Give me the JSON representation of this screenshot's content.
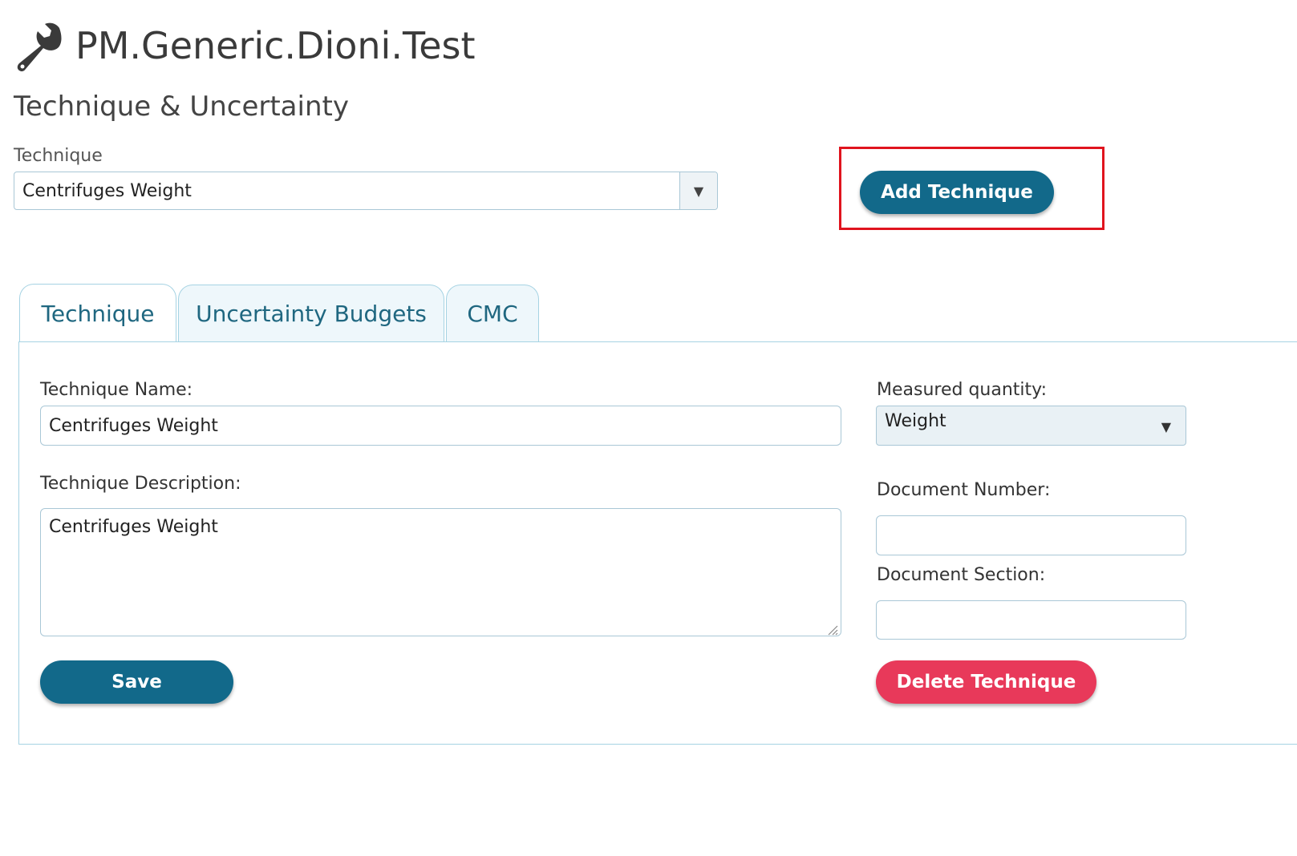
{
  "header": {
    "title": "PM.Generic.Dioni.Test",
    "icon": "wrench-icon"
  },
  "section_title": "Technique & Uncertainty",
  "technique_select": {
    "label": "Technique",
    "value": "Centrifuges Weight"
  },
  "add_technique_label": "Add Technique",
  "tabs": [
    {
      "label": "Technique",
      "active": true
    },
    {
      "label": "Uncertainty Budgets",
      "active": false
    },
    {
      "label": "CMC",
      "active": false
    }
  ],
  "form": {
    "technique_name_label": "Technique Name:",
    "technique_name_value": "Centrifuges Weight",
    "technique_description_label": "Technique Description:",
    "technique_description_value": "Centrifuges Weight",
    "measured_quantity_label": "Measured quantity:",
    "measured_quantity_value": "Weight",
    "document_number_label": "Document Number:",
    "document_number_value": "",
    "document_section_label": "Document Section:",
    "document_section_value": "",
    "save_label": "Save",
    "delete_label": "Delete Technique"
  },
  "colors": {
    "primary": "#12698a",
    "danger": "#e8395a",
    "highlight": "#e0141e",
    "tab_text": "#1f6780"
  }
}
